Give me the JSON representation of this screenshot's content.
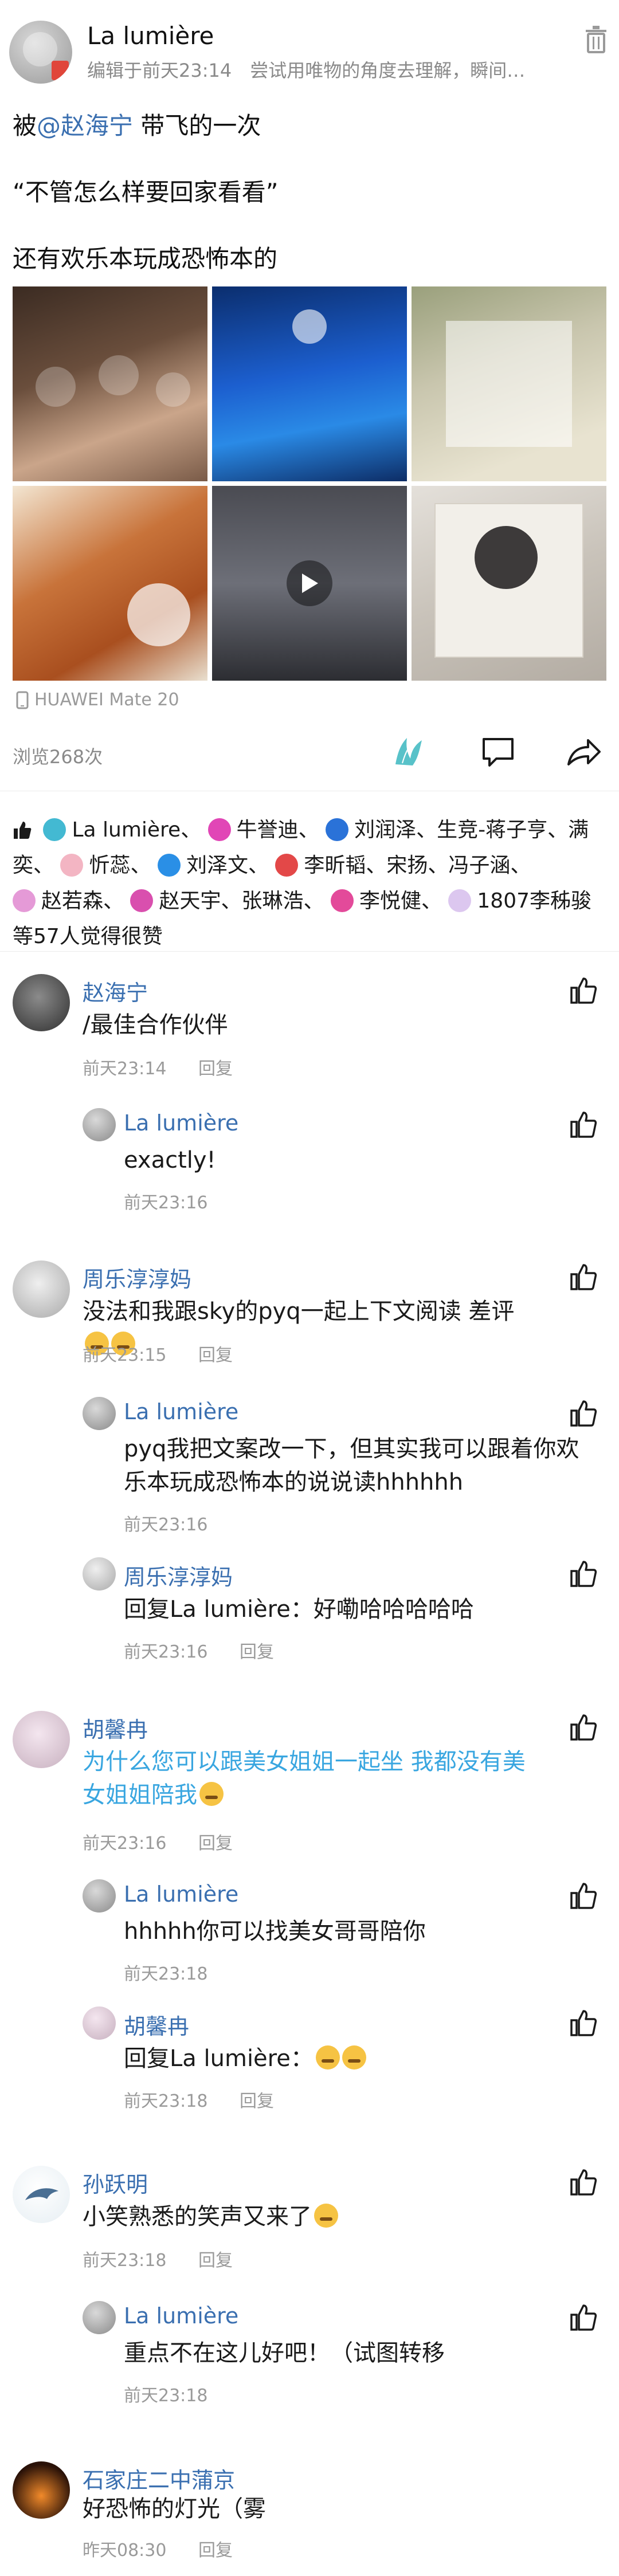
{
  "post": {
    "author": "La lumière",
    "meta": "编辑于前天23:14　尝试用唯物的角度去理解，瞬间就...",
    "line1_prefix": "被",
    "line1_mention": "@赵海宁",
    "line1_suffix": " 带飞的一次",
    "line2": "“不管怎么样要回家看看”",
    "line3": "还有欢乐本玩成恐怖本的",
    "device": "HUAWEI Mate 20",
    "views": "浏览268次"
  },
  "icons": {
    "trash": "trash-icon",
    "play": "play-icon",
    "phone": "phone-icon",
    "like": "like-icon",
    "comment": "comment-icon",
    "share": "share-icon",
    "thumb": "thumb-up-icon"
  },
  "colors": {
    "mention": "#3a6fb0",
    "name": "#3a6fb0",
    "time": "#9a9a9a",
    "highlight_text": "#39a6e0",
    "like_icon": "#58c2c9"
  },
  "likes": [
    {
      "name": "La lumière、",
      "icon_color": "#43b9d2"
    },
    {
      "name": "牛誉迪、",
      "icon_color": "#e146b6"
    },
    {
      "name": "刘润泽、生竞-蒋子亨、满奕、",
      "icon_color": "#2a72d8"
    },
    {
      "name": "忻蕊、",
      "icon_color": "#f3b5c3"
    },
    {
      "name": "刘泽文、",
      "icon_color": "#2a8fe6"
    },
    {
      "name": "李昕韬、宋扬、冯子涵、",
      "icon_color": "#e34848"
    },
    {
      "name": "赵若森、",
      "icon_color": "#e59ad7"
    },
    {
      "name": "赵天宇、张琳浩、",
      "icon_color": "#d94fae"
    },
    {
      "name": "李悦健、",
      "icon_color": "#e34a9a"
    },
    {
      "name": "1807李秭骏等57人觉得很赞",
      "icon_color": "#dcc7ef"
    }
  ],
  "comments": [
    {
      "name": "赵海宁",
      "text": "/最佳合作伙伴",
      "time": "前天23:14",
      "reply": "回复"
    },
    {
      "name": "La lumière",
      "text": "exactly!",
      "time": "前天23:16"
    },
    {
      "name": "周乐淳淳妈",
      "text": "没法和我跟sky的pyq一起上下文阅读 差评",
      "time": "前天23:15",
      "reply": "回复"
    },
    {
      "name": "La lumière",
      "text": "pyq我把文案改一下，但其实我可以跟着你欢乐本玩成恐怖本的说说读hhhhhh",
      "time": "前天23:16"
    },
    {
      "name": "周乐淳淳妈",
      "text": "回复La lumière：好嘞哈哈哈哈哈",
      "time": "前天23:16",
      "reply": "回复"
    },
    {
      "name": "胡馨冉",
      "text": "为什么您可以跟美女姐姐一起坐 我都没有美女姐姐陪我",
      "time": "前天23:16",
      "reply": "回复"
    },
    {
      "name": "La lumière",
      "text": "hhhhh你可以找美女哥哥陪你",
      "time": "前天23:18"
    },
    {
      "name": "胡馨冉",
      "text": "回复La lumière：",
      "time": "前天23:18",
      "reply": "回复"
    },
    {
      "name": "孙跃明",
      "text": "小笑熟悉的笑声又来了",
      "time": "前天23:18",
      "reply": "回复"
    },
    {
      "name": "La lumière",
      "text": "重点不在这儿好吧！（试图转移",
      "time": "前天23:18"
    },
    {
      "name": "石家庄二中蒲京",
      "text": "好恐怖的灯光（雾",
      "time": "昨天08:30",
      "reply": "回复"
    }
  ]
}
